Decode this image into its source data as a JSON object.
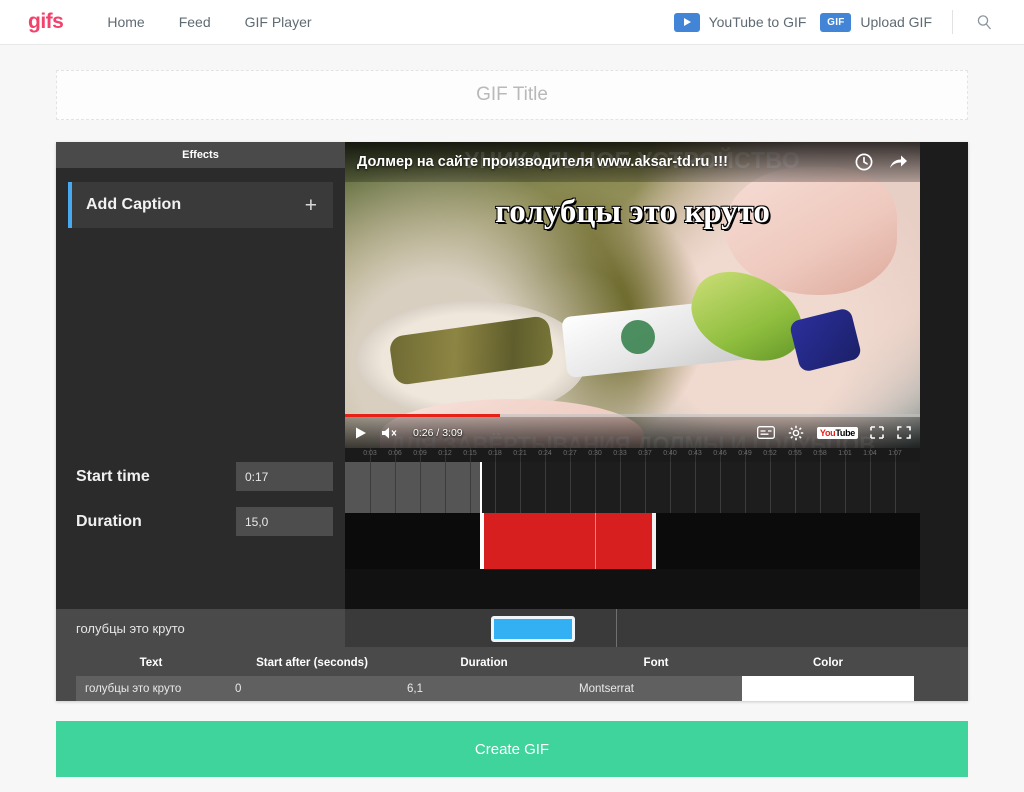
{
  "nav": {
    "brand": "gifs",
    "links": [
      {
        "label": "Home",
        "name": "nav-link-home"
      },
      {
        "label": "Feed",
        "name": "nav-link-feed"
      },
      {
        "label": "GIF Player",
        "name": "nav-link-gif-player"
      }
    ],
    "youtube_to_gif": "YouTube to GIF",
    "gif_badge": "GIF",
    "upload_gif": "Upload GIF"
  },
  "title": {
    "value": "",
    "placeholder": "GIF Title"
  },
  "editor": {
    "effects_tab": "Effects",
    "add_caption": "Add Caption",
    "add_caption_plus": "+",
    "start_time_label": "Start time",
    "start_time_value": "0:17",
    "duration_label": "Duration",
    "duration_value": "15,0"
  },
  "video": {
    "overlay_title": "Долмер на сайте производителя www.aksar-td.ru !!!",
    "ghost_title": "УНИКАЛЬНОЕ УСТРОЙСТВО",
    "ghost_subtitle": "ДЛЯ ЗАВЁРТЫВАНИЯ ДОЛМЫ И ГОЛУБЦОВ",
    "caption_text": "голубцы это круто",
    "time_display": "0:26 / 3:09",
    "progress_percent": 27,
    "yt_logo_you": "You",
    "yt_logo_tube": "Tube"
  },
  "timeline": {
    "ticks": [
      "0:03",
      "0:06",
      "0:09",
      "0:12",
      "0:15",
      "0:18",
      "0:21",
      "0:24",
      "0:27",
      "0:30",
      "0:33",
      "0:37",
      "0:40",
      "0:43",
      "0:46",
      "0:49",
      "0:52",
      "0:55",
      "0:58",
      "1:01",
      "1:04",
      "1:07"
    ],
    "selection_start_pct": 23.5,
    "selection_end_pct": 54.0,
    "playhead_pct": 23.5,
    "playhead2_pct": 43.5,
    "caption_bar_start_pct": 23.5,
    "caption_bar_end_pct": 37.0
  },
  "caption": {
    "header_text": "голубцы это круто",
    "collapse_icon": "▲",
    "columns": [
      {
        "header": "Text",
        "value": "голубцы это круто",
        "name": "caption-text"
      },
      {
        "header": "Start after (seconds)",
        "value": "0",
        "name": "caption-start-after"
      },
      {
        "header": "Duration",
        "value": "6,1",
        "name": "caption-duration"
      },
      {
        "header": "Font",
        "value": "Montserrat",
        "name": "caption-font"
      },
      {
        "header": "Color",
        "value": "#ffffff",
        "name": "caption-color"
      }
    ]
  },
  "footer": {
    "create_gif": "Create GIF"
  },
  "colors": {
    "brand": "#f2416b",
    "accent_blue": "#4285d6",
    "caption_blue": "#33b0f4",
    "selection_red": "#d81f1f",
    "create_green": "#3fd49b"
  }
}
